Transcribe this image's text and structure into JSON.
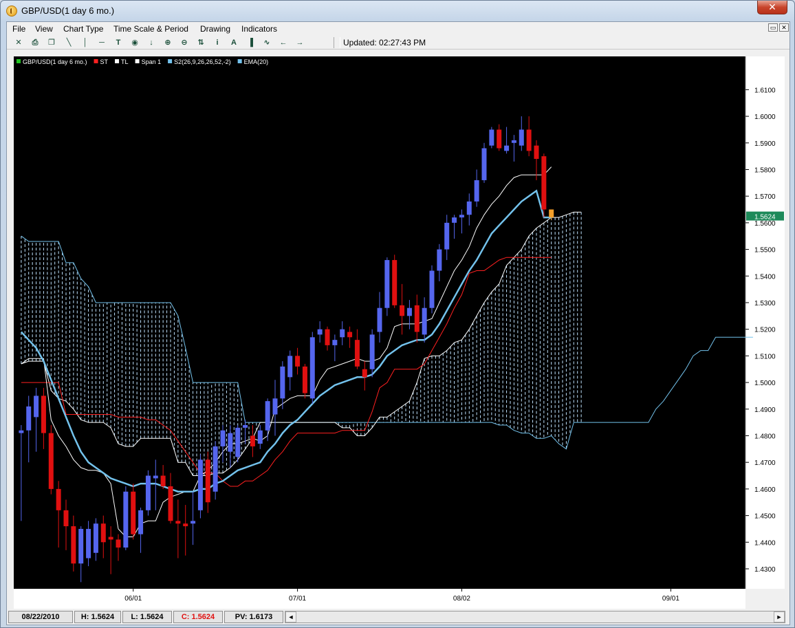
{
  "window": {
    "title": "GBP/USD(1 day  6 mo.)",
    "close_glyph": "✕"
  },
  "menu": [
    "File",
    "View",
    "Chart Type",
    "Time Scale & Period",
    "Drawing",
    "Indicators"
  ],
  "mdi": {
    "restore_glyph": "▭",
    "close_glyph": "✕"
  },
  "toolbar": {
    "icons": [
      "crosshair-icon",
      "print-icon",
      "copy-icon",
      "trendline-icon",
      "vertical-line-icon",
      "horizontal-line-icon",
      "text-tool-icon",
      "target-icon",
      "arrow-down-icon",
      "zoom-in-icon",
      "zoom-out-icon",
      "fit-icon",
      "info-icon",
      "annotation-icon",
      "volume-icon",
      "indicator-icon",
      "scroll-left-icon",
      "scroll-right-icon"
    ],
    "glyphs": [
      "✕",
      "⎙",
      "❐",
      "╲",
      "│",
      "─",
      "T",
      "◉",
      "↓",
      "⊕",
      "⊖",
      "⇅",
      "i",
      "A",
      "▐",
      "∿",
      "←",
      "→"
    ],
    "updated": "Updated: 02:27:43 PM"
  },
  "chart_data": {
    "type": "candlestick",
    "legend": [
      {
        "name": "GBP/USD(1 day  6 mo.)",
        "color": "#22c422"
      },
      {
        "name": "ST",
        "color": "#ff2020"
      },
      {
        "name": "TL",
        "color": "#ffffff"
      },
      {
        "name": "Span 1",
        "color": "#ffffff"
      },
      {
        "name": "S2(26,9,26,26,52,-2)",
        "color": "#73c2ec"
      },
      {
        "name": "EMA(20)",
        "color": "#73c2ec"
      }
    ],
    "y_ticks": [
      1.61,
      1.6,
      1.59,
      1.58,
      1.57,
      1.56,
      1.55,
      1.54,
      1.53,
      1.52,
      1.51,
      1.5,
      1.49,
      1.48,
      1.47,
      1.46,
      1.45,
      1.44,
      1.43
    ],
    "y_tick_labels": [
      "1.6100",
      "1.6000",
      "1.5900",
      "1.5800",
      "1.5700",
      "1.5600",
      "1.5500",
      "1.5400",
      "1.5300",
      "1.5200",
      "1.5100",
      "1.5000",
      "1.4900",
      "1.4800",
      "1.4700",
      "1.4600",
      "1.4500",
      "1.4400",
      "1.4300"
    ],
    "ylim": [
      1.4225,
      1.6225
    ],
    "last_price": 1.5624,
    "last_price_label": "1.5624",
    "x_labels": [
      "06/01",
      "07/01",
      "08/02",
      "09/01"
    ],
    "x_label_index": [
      15,
      37,
      59,
      87
    ],
    "x_range": [
      -1,
      97
    ],
    "colors": {
      "up": "#5566ee",
      "down": "#e01010",
      "last": "#f5a02a",
      "st": "#ff2020",
      "tl": "#ffffff",
      "span1": "#ffffff",
      "span2": "#73c2ec",
      "ema": "#73c2ec",
      "cloud": "#bfe3ff"
    },
    "candles": [
      [
        1.481,
        1.484,
        1.448,
        1.482
      ],
      [
        1.482,
        1.495,
        1.47,
        1.491
      ],
      [
        1.487,
        1.498,
        1.474,
        1.495
      ],
      [
        1.495,
        1.498,
        1.475,
        1.481
      ],
      [
        1.481,
        1.484,
        1.458,
        1.46
      ],
      [
        1.46,
        1.463,
        1.438,
        1.452
      ],
      [
        1.452,
        1.456,
        1.437,
        1.446
      ],
      [
        1.446,
        1.45,
        1.429,
        1.432
      ],
      [
        1.432,
        1.446,
        1.425,
        1.445
      ],
      [
        1.434,
        1.448,
        1.431,
        1.445
      ],
      [
        1.436,
        1.449,
        1.433,
        1.447
      ],
      [
        1.447,
        1.45,
        1.434,
        1.44
      ],
      [
        1.442,
        1.446,
        1.428,
        1.441
      ],
      [
        1.441,
        1.443,
        1.433,
        1.438
      ],
      [
        1.438,
        1.461,
        1.437,
        1.459
      ],
      [
        1.459,
        1.462,
        1.441,
        1.443
      ],
      [
        1.443,
        1.453,
        1.436,
        1.452
      ],
      [
        1.452,
        1.467,
        1.45,
        1.465
      ],
      [
        1.464,
        1.471,
        1.452,
        1.465
      ],
      [
        1.465,
        1.469,
        1.46,
        1.461
      ],
      [
        1.461,
        1.466,
        1.447,
        1.448
      ],
      [
        1.448,
        1.456,
        1.434,
        1.447
      ],
      [
        1.447,
        1.454,
        1.435,
        1.446
      ],
      [
        1.447,
        1.459,
        1.439,
        1.448
      ],
      [
        1.452,
        1.473,
        1.449,
        1.471
      ],
      [
        1.471,
        1.474,
        1.451,
        1.455
      ],
      [
        1.459,
        1.478,
        1.456,
        1.476
      ],
      [
        1.476,
        1.484,
        1.47,
        1.482
      ],
      [
        1.474,
        1.484,
        1.468,
        1.481
      ],
      [
        1.472,
        1.484,
        1.47,
        1.483
      ],
      [
        1.483,
        1.486,
        1.477,
        1.484
      ],
      [
        1.48,
        1.484,
        1.472,
        1.476
      ],
      [
        1.477,
        1.484,
        1.475,
        1.482
      ],
      [
        1.482,
        1.494,
        1.478,
        1.493
      ],
      [
        1.488,
        1.501,
        1.48,
        1.494
      ],
      [
        1.494,
        1.508,
        1.49,
        1.506
      ],
      [
        1.502,
        1.512,
        1.497,
        1.51
      ],
      [
        1.51,
        1.513,
        1.503,
        1.506
      ],
      [
        1.506,
        1.507,
        1.494,
        1.496
      ],
      [
        1.494,
        1.519,
        1.492,
        1.517
      ],
      [
        1.518,
        1.523,
        1.515,
        1.52
      ],
      [
        1.52,
        1.521,
        1.512,
        1.514
      ],
      [
        1.514,
        1.518,
        1.508,
        1.516
      ],
      [
        1.517,
        1.523,
        1.514,
        1.52
      ],
      [
        1.519,
        1.521,
        1.513,
        1.517
      ],
      [
        1.516,
        1.52,
        1.505,
        1.506
      ],
      [
        1.505,
        1.508,
        1.497,
        1.502
      ],
      [
        1.505,
        1.52,
        1.502,
        1.518
      ],
      [
        1.519,
        1.534,
        1.515,
        1.528
      ],
      [
        1.528,
        1.547,
        1.525,
        1.546
      ],
      [
        1.546,
        1.548,
        1.528,
        1.529
      ],
      [
        1.529,
        1.537,
        1.518,
        1.525
      ],
      [
        1.525,
        1.531,
        1.52,
        1.528
      ],
      [
        1.529,
        1.533,
        1.515,
        1.519
      ],
      [
        1.518,
        1.532,
        1.515,
        1.528
      ],
      [
        1.528,
        1.544,
        1.526,
        1.542
      ],
      [
        1.542,
        1.552,
        1.538,
        1.55
      ],
      [
        1.55,
        1.563,
        1.546,
        1.56
      ],
      [
        1.56,
        1.563,
        1.554,
        1.562
      ],
      [
        1.562,
        1.565,
        1.556,
        1.563
      ],
      [
        1.563,
        1.571,
        1.559,
        1.568
      ],
      [
        1.568,
        1.58,
        1.566,
        1.576
      ],
      [
        1.576,
        1.59,
        1.575,
        1.588
      ],
      [
        1.589,
        1.596,
        1.588,
        1.595
      ],
      [
        1.595,
        1.597,
        1.587,
        1.588
      ],
      [
        1.587,
        1.596,
        1.586,
        1.589
      ],
      [
        1.59,
        1.593,
        1.583,
        1.591
      ],
      [
        1.589,
        1.6,
        1.587,
        1.595
      ],
      [
        1.595,
        1.6,
        1.585,
        1.587
      ],
      [
        1.589,
        1.591,
        1.576,
        1.584
      ],
      [
        1.585,
        1.586,
        1.562,
        1.565
      ],
      [
        1.562,
        1.565,
        1.561,
        1.565
      ]
    ],
    "ema": [
      1.519,
      1.516,
      1.513,
      1.508,
      1.501,
      1.494,
      1.487,
      1.48,
      1.474,
      1.47,
      1.468,
      1.466,
      1.464,
      1.463,
      1.462,
      1.461,
      1.462,
      1.462,
      1.462,
      1.461,
      1.46,
      1.459,
      1.459,
      1.459,
      1.46,
      1.46,
      1.462,
      1.463,
      1.465,
      1.467,
      1.468,
      1.469,
      1.47,
      1.474,
      1.477,
      1.481,
      1.484,
      1.486,
      1.489,
      1.492,
      1.495,
      1.497,
      1.499,
      1.5,
      1.501,
      1.502,
      1.502,
      1.503,
      1.506,
      1.51,
      1.512,
      1.514,
      1.515,
      1.516,
      1.516,
      1.518,
      1.522,
      1.527,
      1.532,
      1.537,
      1.542,
      1.546,
      1.551,
      1.556,
      1.559,
      1.562,
      1.565,
      1.568,
      1.57,
      1.572,
      1.562,
      1.562
    ],
    "tl": [
      1.507,
      1.509,
      1.509,
      1.509,
      1.486,
      1.48,
      1.476,
      1.471,
      1.468,
      1.467,
      1.467,
      1.466,
      1.462,
      1.445,
      1.442,
      1.442,
      1.447,
      1.448,
      1.448,
      1.455,
      1.457,
      1.458,
      1.459,
      1.459,
      1.465,
      1.467,
      1.47,
      1.474,
      1.477,
      1.477,
      1.478,
      1.479,
      1.478,
      1.48,
      1.49,
      1.492,
      1.494,
      1.495,
      1.495,
      1.495,
      1.501,
      1.505,
      1.506,
      1.507,
      1.508,
      1.509,
      1.508,
      1.508,
      1.509,
      1.513,
      1.521,
      1.522,
      1.522,
      1.522,
      1.523,
      1.524,
      1.53,
      1.536,
      1.542,
      1.546,
      1.551,
      1.558,
      1.563,
      1.567,
      1.57,
      1.574,
      1.577,
      1.578,
      1.578,
      1.578,
      1.578,
      1.581
    ],
    "st": [
      1.5,
      1.5,
      1.5,
      1.5,
      1.5,
      1.5,
      1.488,
      1.488,
      1.488,
      1.488,
      1.488,
      1.488,
      1.488,
      1.487,
      1.487,
      1.487,
      1.487,
      1.486,
      1.486,
      1.484,
      1.482,
      1.478,
      1.474,
      1.47,
      1.466,
      1.466,
      1.466,
      1.463,
      1.461,
      1.461,
      1.463,
      1.463,
      1.465,
      1.467,
      1.471,
      1.474,
      1.478,
      1.481,
      1.481,
      1.481,
      1.481,
      1.481,
      1.481,
      1.482,
      1.482,
      1.482,
      1.482,
      1.489,
      1.498,
      1.5,
      1.505,
      1.505,
      1.505,
      1.505,
      1.507,
      1.512,
      1.517,
      1.522,
      1.528,
      1.533,
      1.541,
      1.542,
      1.542,
      1.544,
      1.546,
      1.547,
      1.547,
      1.547,
      1.547,
      1.547,
      1.547,
      1.547
    ],
    "span1": [
      1.507,
      1.508,
      1.508,
      1.508,
      1.497,
      1.494,
      1.493,
      1.49,
      1.486,
      1.485,
      1.485,
      1.485,
      1.483,
      1.477,
      1.476,
      1.476,
      1.479,
      1.479,
      1.479,
      1.479,
      1.479,
      1.47,
      1.47,
      1.465,
      1.465,
      1.465,
      1.466,
      1.466,
      1.468,
      1.471,
      1.475,
      1.479,
      1.485,
      1.485,
      1.485,
      1.485,
      1.485,
      1.485,
      1.485,
      1.485,
      1.485,
      1.485,
      1.485,
      1.483,
      1.483,
      1.48,
      1.48,
      1.483,
      1.487,
      1.487,
      1.489,
      1.491,
      1.493,
      1.5,
      1.509,
      1.51,
      1.51,
      1.512,
      1.515,
      1.516,
      1.52,
      1.525,
      1.53,
      1.534,
      1.537,
      1.544,
      1.547,
      1.55,
      1.555,
      1.558,
      1.56,
      1.562,
      1.562,
      1.563,
      1.564,
      1.564
    ],
    "span2": [
      1.555,
      1.553,
      1.553,
      1.553,
      1.553,
      1.553,
      1.545,
      1.545,
      1.539,
      1.536,
      1.53,
      1.53,
      1.53,
      1.53,
      1.53,
      1.53,
      1.53,
      1.53,
      1.53,
      1.53,
      1.53,
      1.525,
      1.513,
      1.5,
      1.5,
      1.5,
      1.5,
      1.5,
      1.5,
      1.5,
      1.485,
      1.485,
      1.485,
      1.485,
      1.485,
      1.485,
      1.485,
      1.485,
      1.485,
      1.485,
      1.485,
      1.485,
      1.485,
      1.485,
      1.485,
      1.485,
      1.485,
      1.485,
      1.485,
      1.485,
      1.485,
      1.485,
      1.485,
      1.485,
      1.485,
      1.485,
      1.485,
      1.485,
      1.485,
      1.485,
      1.485,
      1.485,
      1.485,
      1.485,
      1.484,
      1.484,
      1.482,
      1.481,
      1.481,
      1.479,
      1.479,
      1.48,
      1.477,
      1.475,
      1.485,
      1.485,
      1.485,
      1.485,
      1.485,
      1.485,
      1.485,
      1.485,
      1.485,
      1.485,
      1.485,
      1.49,
      1.493,
      1.497,
      1.501,
      1.505,
      1.51,
      1.512,
      1.512,
      1.517,
      1.517,
      1.517,
      1.517,
      1.517,
      1.517
    ]
  },
  "status": {
    "date": "08/22/2010",
    "high": "H: 1.5624",
    "low": "L: 1.5624",
    "close": "C: 1.5624",
    "pv": "PV: 1.6173",
    "scroll_left": "◄",
    "scroll_right": "►"
  }
}
